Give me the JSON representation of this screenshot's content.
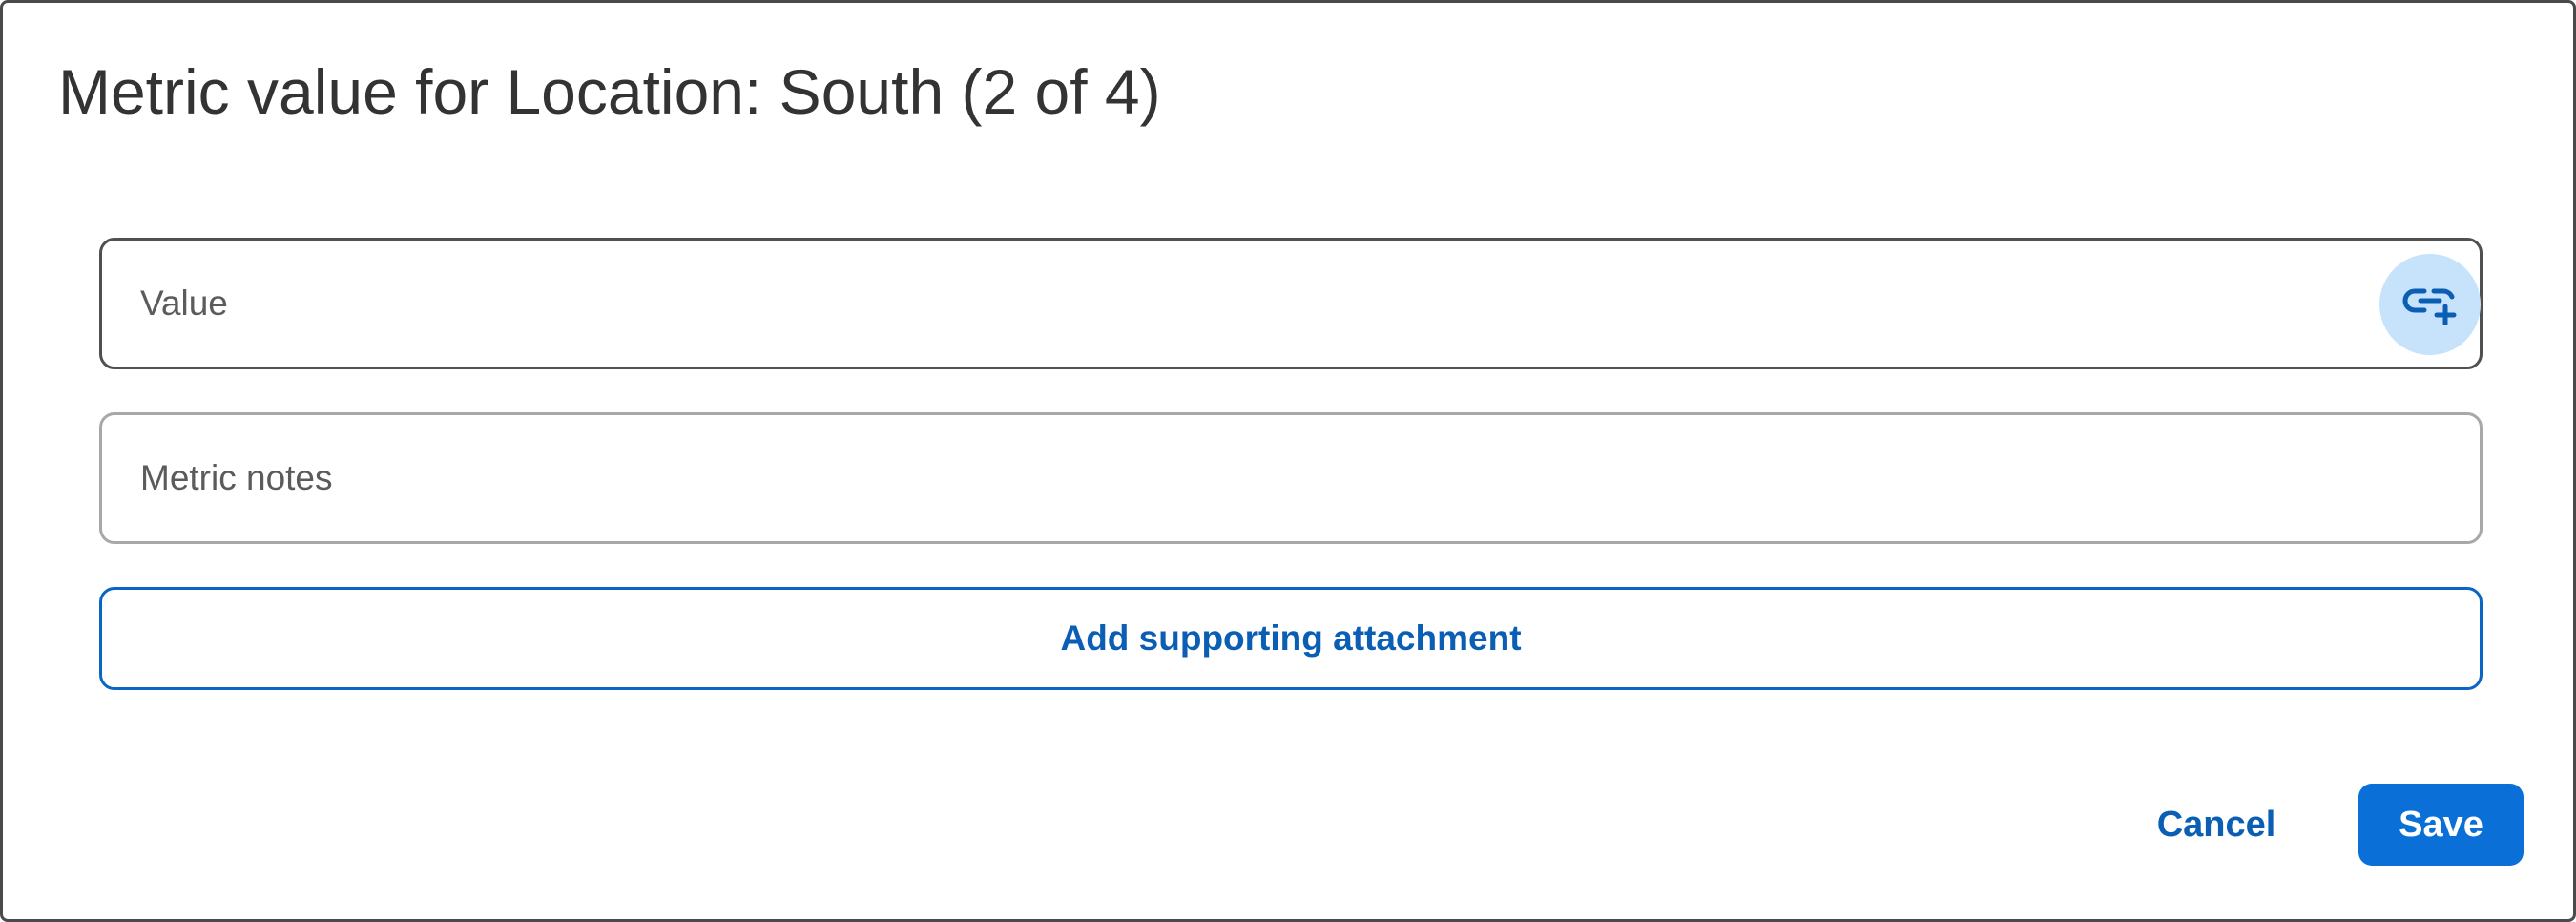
{
  "dialog": {
    "title": "Metric value for Location: South (2 of 4)"
  },
  "form": {
    "value_placeholder": "Value",
    "value": "",
    "notes_placeholder": "Metric notes",
    "notes": "",
    "attach_label": "Add supporting attachment",
    "link_icon": "link-add-icon"
  },
  "actions": {
    "cancel_label": "Cancel",
    "save_label": "Save"
  },
  "colors": {
    "accent": "#0a66c2",
    "primary_button": "#0a6fd6",
    "link_button_bg": "#c6e3fb",
    "title_text": "#333333"
  }
}
